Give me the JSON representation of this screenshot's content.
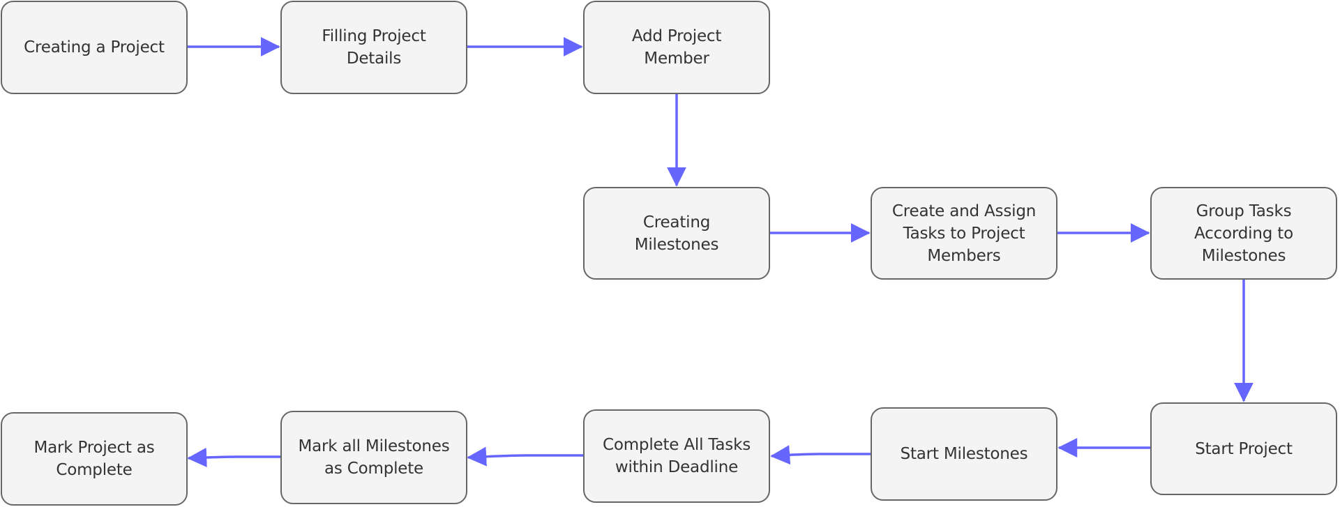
{
  "diagram": {
    "type": "flowchart",
    "colors": {
      "node_fill": "#f4f4f4",
      "node_border": "#666666",
      "text": "#333333",
      "edge": "#6666ff"
    },
    "nodes": [
      {
        "id": "n1",
        "label": "Creating a Project"
      },
      {
        "id": "n2",
        "label": "Filling Project\nDetails"
      },
      {
        "id": "n3",
        "label": "Add Project\nMember"
      },
      {
        "id": "n4",
        "label": "Creating\nMilestones"
      },
      {
        "id": "n5",
        "label": "Create and Assign\nTasks to Project\nMembers"
      },
      {
        "id": "n6",
        "label": "Group Tasks\nAccording to\nMilestones"
      },
      {
        "id": "n7",
        "label": "Start Project"
      },
      {
        "id": "n8",
        "label": "Start Milestones"
      },
      {
        "id": "n9",
        "label": "Complete All Tasks\nwithin Deadline"
      },
      {
        "id": "n10",
        "label": "Mark all Milestones\nas Complete"
      },
      {
        "id": "n11",
        "label": "Mark Project as\nComplete"
      }
    ],
    "edges": [
      {
        "from": "n1",
        "to": "n2"
      },
      {
        "from": "n2",
        "to": "n3"
      },
      {
        "from": "n3",
        "to": "n4"
      },
      {
        "from": "n4",
        "to": "n5"
      },
      {
        "from": "n5",
        "to": "n6"
      },
      {
        "from": "n6",
        "to": "n7"
      },
      {
        "from": "n7",
        "to": "n8"
      },
      {
        "from": "n8",
        "to": "n9"
      },
      {
        "from": "n9",
        "to": "n10"
      },
      {
        "from": "n10",
        "to": "n11"
      }
    ]
  }
}
